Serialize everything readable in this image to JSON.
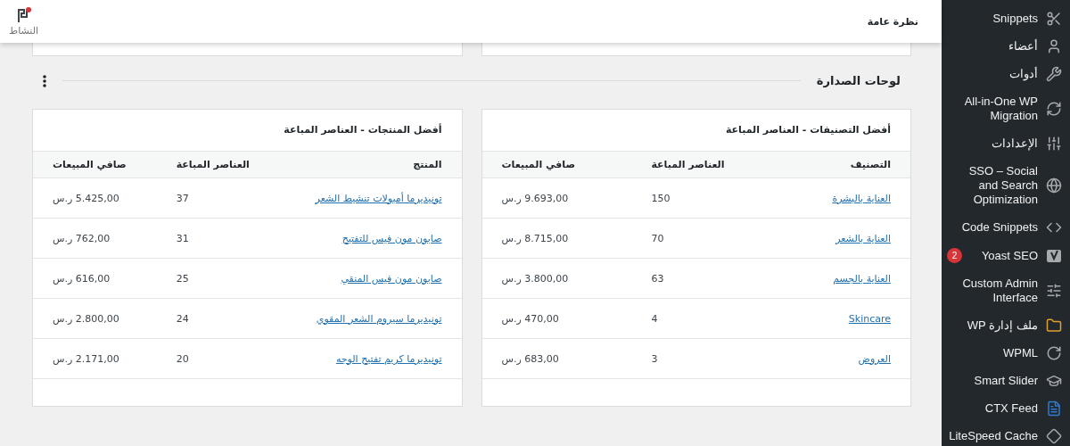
{
  "header": {
    "title": "نظرة عامة",
    "activity": "النشاط"
  },
  "section": {
    "title": "لوحات الصدارة"
  },
  "leaderboards": [
    {
      "title": "أفضل التصنيفات - العناصر المباعة",
      "columns": [
        "التصنيف",
        "العناصر المباعة",
        "صافي المبيعات"
      ],
      "rows": [
        {
          "name": "العناية بالبشرة",
          "items": "150",
          "net": "9.693,00 ر.س"
        },
        {
          "name": "العناية بالشعر",
          "items": "70",
          "net": "8.715,00 ر.س"
        },
        {
          "name": "العناية بالجسم",
          "items": "63",
          "net": "3.800,00 ر.س"
        },
        {
          "name": "Skincare",
          "items": "4",
          "net": "470,00 ر.س"
        },
        {
          "name": "العروض",
          "items": "3",
          "net": "683,00 ر.س"
        }
      ]
    },
    {
      "title": "أفضل المنتجات - العناصر المباعة",
      "columns": [
        "المنتج",
        "العناصر المباعة",
        "صافي المبيعات"
      ],
      "rows": [
        {
          "name": "تونيديرما أمبولات تنشيط الشعر",
          "items": "37",
          "net": "5.425,00 ر.س"
        },
        {
          "name": "صابون مون فيس للتفتيح",
          "items": "31",
          "net": "762,00 ر.س"
        },
        {
          "name": "صابون مون فيس المنقي",
          "items": "25",
          "net": "616,00 ر.س"
        },
        {
          "name": "تونيديرما سيروم الشعر المقوي",
          "items": "24",
          "net": "2.800,00 ر.س"
        },
        {
          "name": "تونيديرما كريم تفتيح الوجه",
          "items": "20",
          "net": "2.171,00 ر.س"
        }
      ]
    }
  ],
  "sidebar": {
    "items": [
      {
        "label": "Snippets"
      },
      {
        "label": "أعضاء"
      },
      {
        "label": "أدوات"
      },
      {
        "label": "All-in-One WP Migration"
      },
      {
        "label": "الإعدادات"
      },
      {
        "label": "SSO – Social and Search Optimization"
      },
      {
        "label": "Code Snippets"
      },
      {
        "label": "Yoast SEO",
        "badge": "2"
      },
      {
        "label": "Custom Admin Interface"
      },
      {
        "label": "ملف إدارة WP"
      },
      {
        "label": "WPML"
      },
      {
        "label": "Smart Slider"
      },
      {
        "label": "CTX Feed"
      },
      {
        "label": "LiteSpeed Cache"
      }
    ]
  }
}
